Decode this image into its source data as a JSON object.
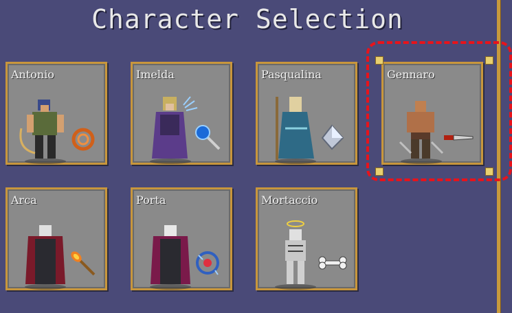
{
  "title": "Character Selection",
  "characters": [
    {
      "name": "Antonio",
      "weapon": "whip-icon",
      "color": "#5a6b3a"
    },
    {
      "name": "Imelda",
      "weapon": "magic-wand-icon",
      "color": "#5b3c8a"
    },
    {
      "name": "Pasqualina",
      "weapon": "crystal-icon",
      "color": "#2e6a86"
    },
    {
      "name": "Gennaro",
      "weapon": "knife-icon",
      "color": "#8a5a3a"
    },
    {
      "name": "Arca",
      "weapon": "fire-wand-icon",
      "color": "#7a1a2a"
    },
    {
      "name": "Porta",
      "weapon": "lightning-ring-icon",
      "color": "#7a1a4a"
    },
    {
      "name": "Mortaccio",
      "weapon": "bone-icon",
      "color": "#d8d8d8"
    }
  ],
  "selected": "Gennaro",
  "colors": {
    "background": "#4a4a78",
    "card": "#8a8a8a",
    "card_border": "#c8963c",
    "selection": "#e8131b"
  }
}
